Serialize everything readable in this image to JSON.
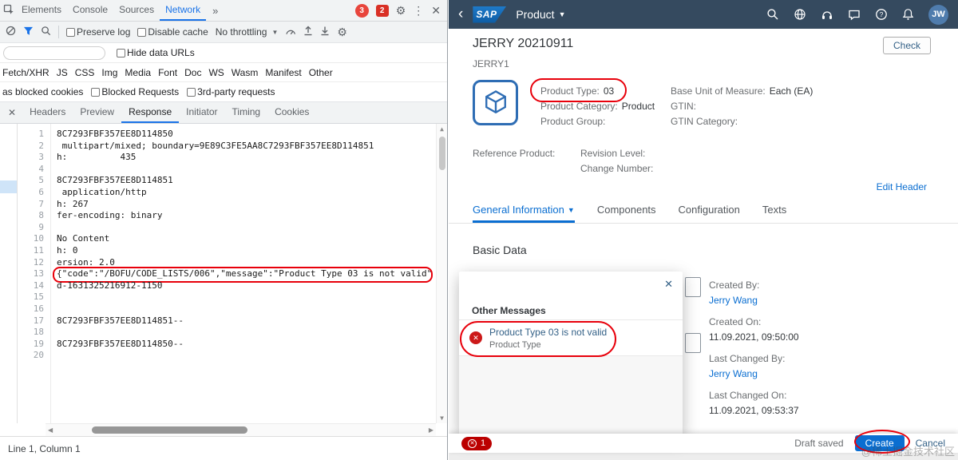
{
  "colors": {
    "devtools_accent": "#1a73e8",
    "sap_shell": "#354a5f",
    "sap_link": "#0a6ed1",
    "error_red": "#bb0000",
    "annotation_red": "#e8000b"
  },
  "devtools": {
    "main_tabs": [
      {
        "label": "Elements"
      },
      {
        "label": "Console"
      },
      {
        "label": "Sources"
      },
      {
        "label": "Network",
        "active": true
      }
    ],
    "error_badge": "3",
    "ext_badge": "2",
    "net_toolbar": {
      "preserve_log": "Preserve log",
      "disable_cache": "Disable cache",
      "throttling": "No throttling"
    },
    "filter": {
      "hide_data_urls": "Hide data URLs"
    },
    "type_filters": [
      "Fetch/XHR",
      "JS",
      "CSS",
      "Img",
      "Media",
      "Font",
      "Doc",
      "WS",
      "Wasm",
      "Manifest",
      "Other"
    ],
    "request_filters": {
      "has_blocked_cookies": "as blocked cookies",
      "blocked_requests": "Blocked Requests",
      "third_party": "3rd-party requests"
    },
    "panel_tabs": [
      {
        "label": "Headers"
      },
      {
        "label": "Preview"
      },
      {
        "label": "Response",
        "active": true
      },
      {
        "label": "Initiator"
      },
      {
        "label": "Timing"
      },
      {
        "label": "Cookies"
      }
    ],
    "response_lines": [
      {
        "n": "1",
        "text": "8C7293FBF357EE8D114850"
      },
      {
        "n": "2",
        "text": " multipart/mixed; boundary=9E89C3FE5AA8C7293FBF357EE8D114851"
      },
      {
        "n": "3",
        "text": "h:          435"
      },
      {
        "n": "4",
        "text": ""
      },
      {
        "n": "5",
        "text": "8C7293FBF357EE8D114851"
      },
      {
        "n": "6",
        "text": " application/http"
      },
      {
        "n": "7",
        "text": "h: 267"
      },
      {
        "n": "8",
        "text": "fer-encoding: binary"
      },
      {
        "n": "9",
        "text": ""
      },
      {
        "n": "10",
        "text": "No Content"
      },
      {
        "n": "11",
        "text": "h: 0"
      },
      {
        "n": "12",
        "text": "ersion: 2.0"
      },
      {
        "n": "13",
        "text": "{\"code\":\"/BOFU/CODE_LISTS/006\",\"message\":\"Product Type 03 is not valid\"",
        "highlight": true
      },
      {
        "n": "14",
        "text": "d-1631325216912-1150"
      },
      {
        "n": "15",
        "text": ""
      },
      {
        "n": "16",
        "text": ""
      },
      {
        "n": "17",
        "text": "8C7293FBF357EE8D114851--"
      },
      {
        "n": "18",
        "text": ""
      },
      {
        "n": "19",
        "text": "8C7293FBF357EE8D114850--"
      },
      {
        "n": "20",
        "text": ""
      }
    ],
    "status_bar": "Line 1, Column 1"
  },
  "sap": {
    "shell": {
      "logo": "SAP",
      "product_menu": "Product",
      "avatar": "JW"
    },
    "header": {
      "title": "JERRY 20210911",
      "subtitle": "JERRY1",
      "check_button": "Check",
      "edit_header": "Edit Header"
    },
    "header_fields_a": [
      {
        "label": "Product Type:",
        "value": "03"
      },
      {
        "label": "Product Category:",
        "value": "Product"
      },
      {
        "label": "Product Group:",
        "value": ""
      }
    ],
    "header_fields_b": [
      {
        "label": "Base Unit of Measure:",
        "value": "Each (EA)"
      },
      {
        "label": "GTIN:",
        "value": ""
      },
      {
        "label": "GTIN Category:",
        "value": ""
      }
    ],
    "header_fields_c": [
      {
        "label": "Reference Product:",
        "value": ""
      }
    ],
    "header_fields_d": [
      {
        "label": "Revision Level:",
        "value": ""
      },
      {
        "label": "Change Number:",
        "value": ""
      }
    ],
    "tabs": [
      {
        "label": "General Information",
        "active": true,
        "caret": true
      },
      {
        "label": "Components"
      },
      {
        "label": "Configuration"
      },
      {
        "label": "Texts"
      }
    ],
    "section_title": "Basic Data",
    "dialog": {
      "title": "Other Messages",
      "message": {
        "title": "Product Type 03 is not valid",
        "subtitle": "Product Type"
      }
    },
    "details": [
      {
        "label": "Created By:",
        "value": "Jerry Wang",
        "link": true
      },
      {
        "label": "Created On:",
        "value": "11.09.2021, 09:50:00"
      },
      {
        "label": "Last Changed By:",
        "value": "Jerry Wang",
        "link": true
      },
      {
        "label": "Last Changed On:",
        "value": "11.09.2021, 09:53:37"
      }
    ],
    "footer": {
      "error_count": "1",
      "draft_status": "Draft saved",
      "create": "Create",
      "cancel": "Cancel"
    },
    "watermark": "@稀土掘金技术社区"
  }
}
